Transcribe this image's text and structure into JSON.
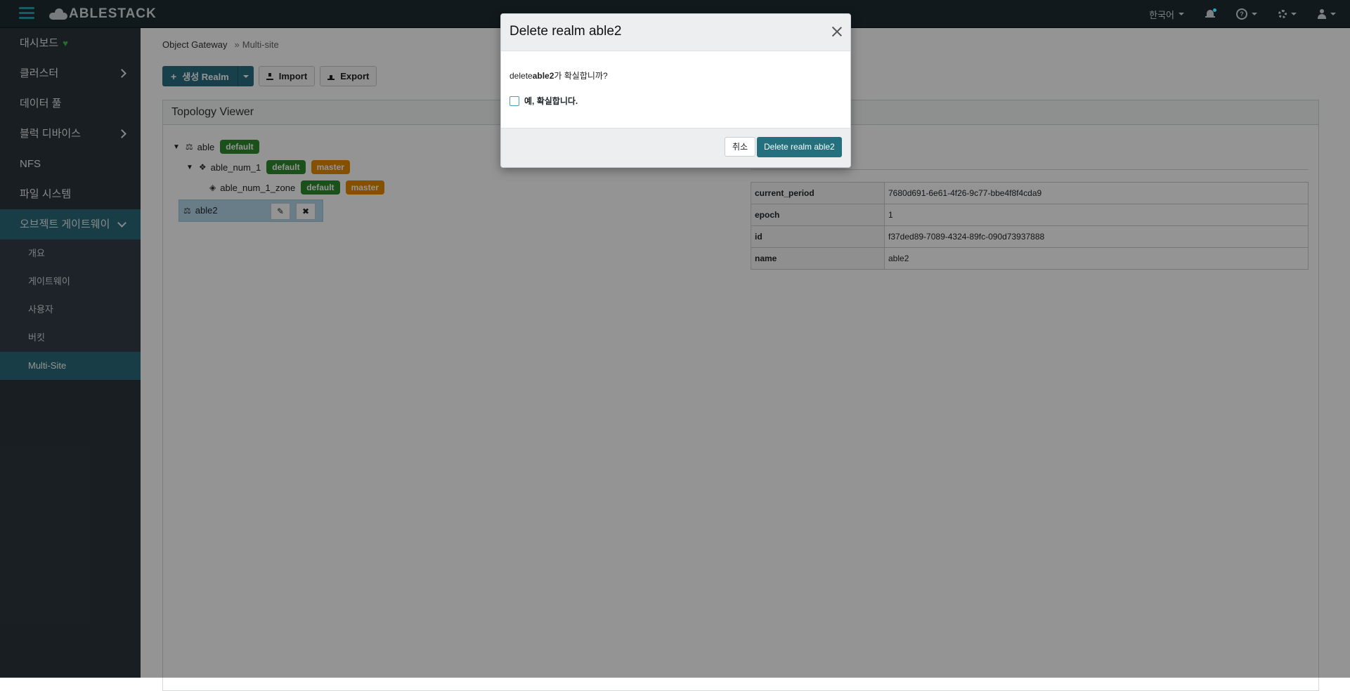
{
  "navbar": {
    "brand": "ABLESTACK",
    "language": "한국어"
  },
  "sidebar": {
    "items": [
      {
        "label": "대시보드"
      },
      {
        "label": "클러스터"
      },
      {
        "label": "데이터 풀"
      },
      {
        "label": "블럭 디바이스"
      },
      {
        "label": "NFS"
      },
      {
        "label": "파일 시스템"
      },
      {
        "label": "오브젝트 게이트웨이"
      }
    ],
    "subitems": [
      {
        "label": "개요"
      },
      {
        "label": "게이트웨이"
      },
      {
        "label": "사용자"
      },
      {
        "label": "버킷"
      },
      {
        "label": "Multi-Site"
      }
    ]
  },
  "breadcrumb": {
    "parent": "Object Gateway",
    "current": "Multi-site"
  },
  "toolbar": {
    "create_label": "생성 Realm",
    "import_label": "Import",
    "export_label": "Export"
  },
  "topology": {
    "title": "Topology Viewer",
    "realm": "able",
    "zonegroup": "able_num_1",
    "zone": "able_num_1_zone",
    "selected_realm": "able2",
    "badges": {
      "default": "default",
      "master": "master"
    }
  },
  "details": [
    {
      "key": "current_period",
      "value": "7680d691-6e61-4f26-9c77-bbe4f8f4cda9"
    },
    {
      "key": "epoch",
      "value": "1"
    },
    {
      "key": "id",
      "value": "f37ded89-7089-4324-89fc-090d73937888"
    },
    {
      "key": "name",
      "value": "able2"
    }
  ],
  "modal": {
    "title": "Delete realm able2",
    "prefix": "delete",
    "target": "able2",
    "suffix": "가 확실합니까?",
    "checkbox_label": "예, 확실합니다.",
    "cancel_label": "취소",
    "confirm_label": "Delete realm able2"
  },
  "colors": {
    "navbar": "#1e2b33",
    "sidebar": "#2b353d",
    "active": "#2a6a79",
    "primary": "#25707f",
    "badge_green": "#2e8b2e",
    "badge_orange": "#e68a00"
  }
}
